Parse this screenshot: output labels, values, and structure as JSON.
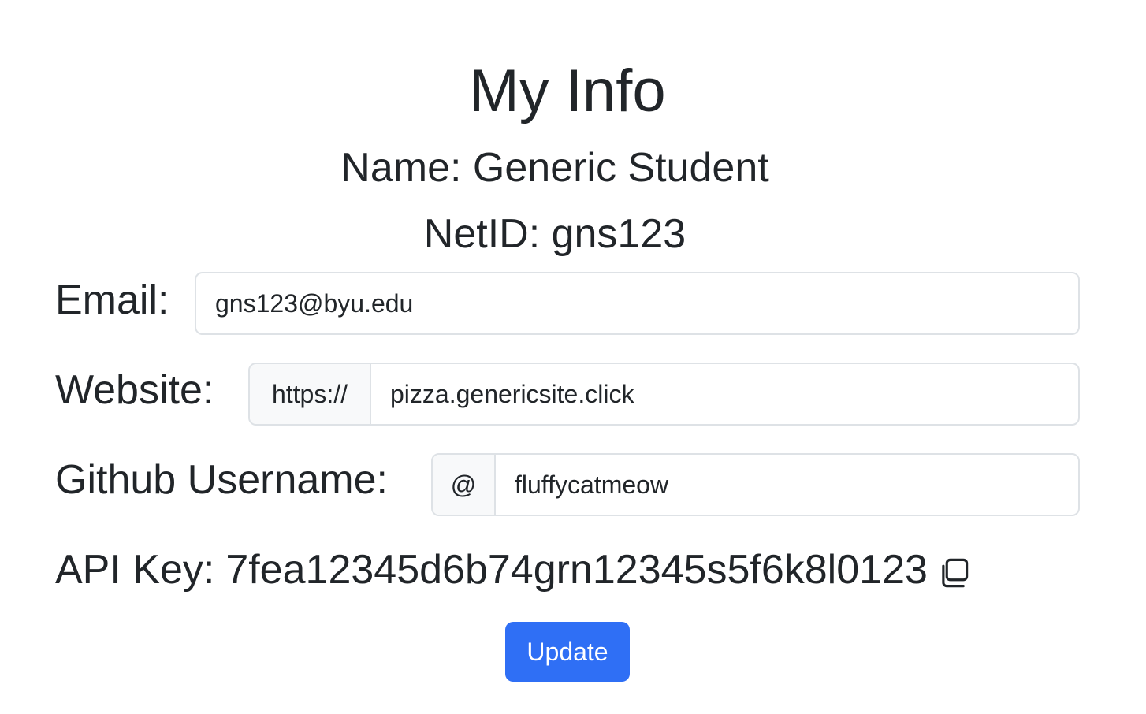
{
  "page": {
    "title": "My Info",
    "name_line": "Name: Generic Student",
    "netid_line": "NetID: gns123"
  },
  "form": {
    "email_label": "Email:",
    "email_value": "gns123@byu.edu",
    "website_label": "Website:",
    "website_prefix": "https://",
    "website_value": "pizza.genericsite.click",
    "github_label": "Github Username:",
    "github_prefix": "@",
    "github_value": "fluffycatmeow",
    "api_key_label": "API Key:",
    "api_key_value": "7fea12345d6b74grn12345s5f6k8l0123",
    "copy_icon": "copy-icon",
    "update_label": "Update"
  },
  "colors": {
    "primary": "#2f6ff5",
    "text": "#212529",
    "border": "#dee2e6",
    "addon_bg": "#f8f9fa"
  }
}
